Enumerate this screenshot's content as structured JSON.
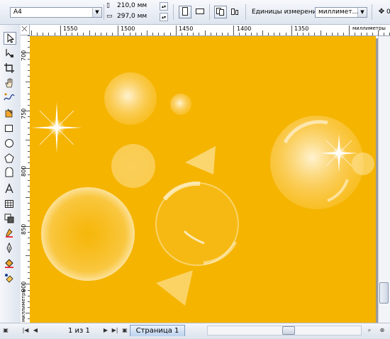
{
  "property_bar": {
    "paper_size": "A4",
    "width_value": "210,0 мм",
    "height_value": "297,0 мм",
    "units_label": "Единицы измерения:",
    "units_value": "миллимет..."
  },
  "rulers": {
    "horizontal_labels": [
      "1550",
      "1500",
      "1450",
      "1400",
      "1350"
    ],
    "horizontal_unit": "миллиметры",
    "vertical_labels": [
      "700",
      "750",
      "800",
      "850",
      "900"
    ],
    "vertical_unit": "миллиметры"
  },
  "page_nav": {
    "page_counter": "1 из 1",
    "page_tab": "Страница 1"
  },
  "colors": {
    "page_fill": "#f5b400",
    "chrome": "#dfe5ef"
  },
  "toolbox": {
    "tools": [
      "pick-tool-icon",
      "shape-tool-icon",
      "crop-tool-icon",
      "zoom-tool-icon",
      "freehand-tool-icon",
      "smart-fill-tool-icon",
      "rectangle-tool-icon",
      "ellipse-tool-icon",
      "polygon-tool-icon",
      "basic-shapes-tool-icon",
      "text-tool-icon",
      "table-tool-icon",
      "interactive-tool-icon",
      "eyedropper-tool-icon",
      "outline-tool-icon",
      "fill-tool-icon",
      "interactive-fill-tool-icon"
    ]
  }
}
